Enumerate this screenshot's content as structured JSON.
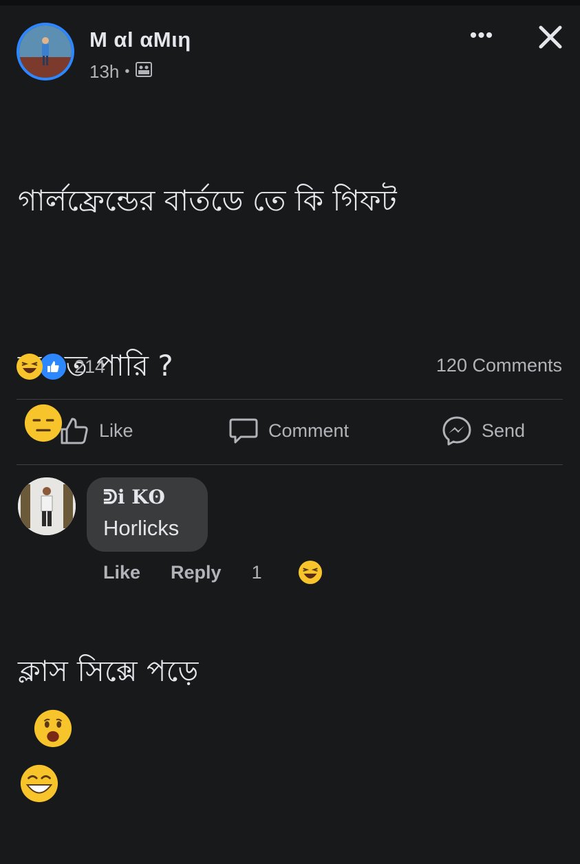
{
  "post": {
    "author": "M αl αMιη",
    "time": "13h",
    "separator": "•",
    "privacy_icon": "friends-icon",
    "more_icon": "•••",
    "close_icon": "close-icon",
    "text_line1": "গার্লফ্রেন্ডের বার্তডে তে কি গিফট",
    "text_line2": "করতে পারি ?",
    "text_line3": "ক্লাস সিক্সে পড়ে",
    "emoji_line2": "expressionless-face",
    "emoji_line3": [
      "frowning-open-mouth-face",
      "grinning-squinting-face"
    ]
  },
  "stats": {
    "reaction_icons": [
      "haha-icon",
      "like-icon"
    ],
    "reaction_count": "214",
    "comments": "120 Comments"
  },
  "actions": {
    "like": "Like",
    "comment": "Comment",
    "send": "Send"
  },
  "comment": {
    "author": "ᕲi Kʘ",
    "text": "Horlicks",
    "like": "Like",
    "reply": "Reply",
    "reaction_count": "1",
    "reaction_icon": "haha-icon"
  },
  "colors": {
    "background": "#18191a",
    "bubble": "#3a3b3c",
    "accent": "#2d88ff",
    "secondary_text": "#b0b3b8"
  }
}
